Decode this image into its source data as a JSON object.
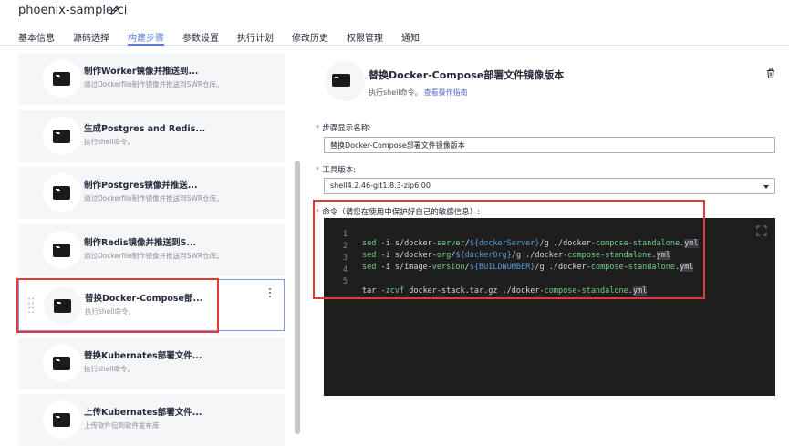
{
  "header": {
    "project_name": "phoenix-sample-ci",
    "tabs": [
      {
        "label": "基本信息"
      },
      {
        "label": "源码选择"
      },
      {
        "label": "构建步骤"
      },
      {
        "label": "参数设置"
      },
      {
        "label": "执行计划"
      },
      {
        "label": "修改历史"
      },
      {
        "label": "权限管理"
      },
      {
        "label": "通知"
      }
    ],
    "active_tab": "构建步骤"
  },
  "steps": [
    {
      "title": "制作Worker镜像并推送到...",
      "desc": "通过Dockerfile制作镜像并推送到SWR仓库。"
    },
    {
      "title": "生成Postgres and Redis...",
      "desc": "执行shell命令。"
    },
    {
      "title": "制作Postgres镜像并推送...",
      "desc": "通过Dockerfile制作镜像并推送到SWR仓库。"
    },
    {
      "title": "制作Redis镜像并推送到S...",
      "desc": "通过Dockerfile制作镜像并推送到SWR仓库。"
    },
    {
      "title": "替换Docker-Compose部...",
      "desc": "执行shell命令。",
      "selected": true
    },
    {
      "title": "替换Kubernates部署文件...",
      "desc": "执行shell命令。"
    },
    {
      "title": "上传Kubernates部署文件...",
      "desc": "上传软件包到软件发布库"
    }
  ],
  "detail": {
    "title": "替换Docker-Compose部署文件镜像版本",
    "subtitle": "执行shell命令。",
    "guide_link": "查看操作指南",
    "name_label": "步骤显示名称:",
    "name_value": "替换Docker-Compose部署文件镜像版本",
    "tool_label": "工具版本:",
    "tool_value": "shell4.2.46-git1.8.3-zip6.00",
    "command_label": "命令（请您在使用中保护好自己的敏感信息）:",
    "code_lines": [
      {
        "num": "1",
        "text": "sed -i s/docker-server/${dockerServer}/g ./docker-compose-standalone.yml"
      },
      {
        "num": "2",
        "text": "sed -i s/docker-org/${dockerOrg}/g ./docker-compose-standalone.yml"
      },
      {
        "num": "3",
        "text": "sed -i s/image-version/${BUILDNUMBER}/g ./docker-compose-standalone.yml"
      },
      {
        "num": "4",
        "text": ""
      },
      {
        "num": "5",
        "text": "tar -zcvf docker-stack.tar.gz ./docker-compose-standalone.yml"
      }
    ]
  },
  "colors": {
    "accent": "#5e7ce0",
    "annotation_red": "#e53935",
    "editor_bg": "#1e1e1e"
  }
}
